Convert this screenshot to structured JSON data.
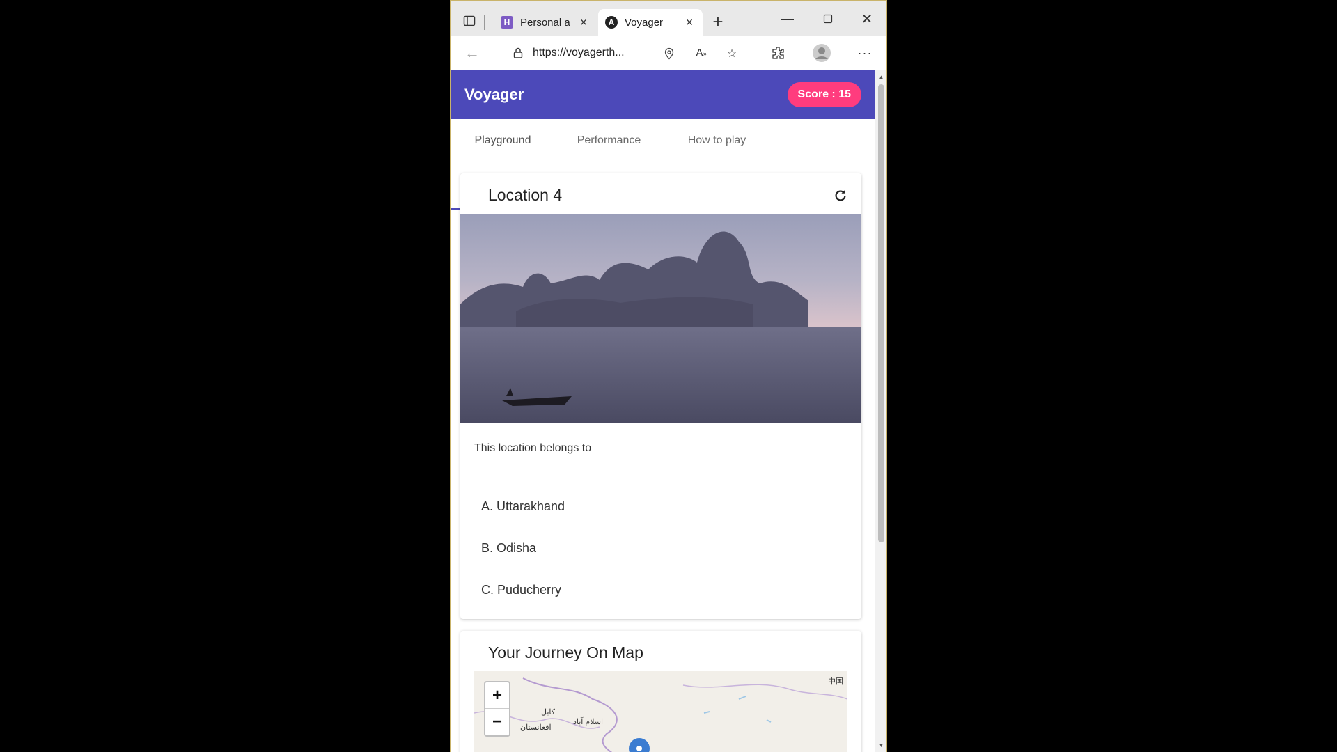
{
  "browser": {
    "tabs": [
      {
        "title": "Personal a",
        "favicon": "H"
      },
      {
        "title": "Voyager",
        "favicon": "A"
      }
    ],
    "url": "https://voyagerth..."
  },
  "app": {
    "title": "Voyager",
    "score": "Score : 15",
    "nav_tabs": [
      "Playground",
      "Performance",
      "How to play"
    ],
    "accent": "#4c49b9",
    "score_color": "#ff3c7e"
  },
  "quiz": {
    "title": "Location 4",
    "question": "This location belongs to",
    "options": [
      "A. Uttarakhand",
      "B. Odisha",
      "C. Puducherry"
    ]
  },
  "map": {
    "title": "Your Journey On Map",
    "zoom_in": "+",
    "zoom_out": "−",
    "labels": [
      "کابل",
      "اسلام آباد",
      "افغانستان",
      "中国"
    ]
  }
}
